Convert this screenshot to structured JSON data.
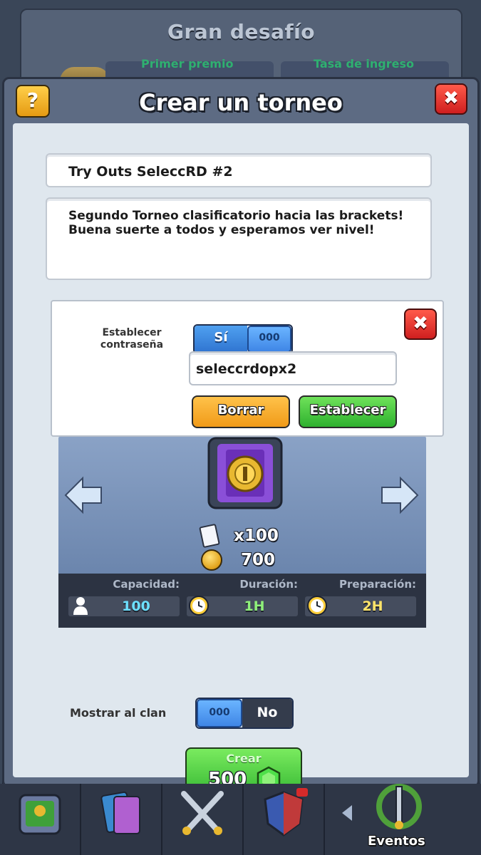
{
  "background": {
    "title": "Gran desafío",
    "first_prize_label": "Primer premio",
    "entry_fee_label": "Tasa de ingreso"
  },
  "modal": {
    "title": "Crear un torneo",
    "help_label": "?",
    "close_label": "✖"
  },
  "tournament": {
    "name": "Try Outs SeleccRD #2",
    "description": "Segundo Torneo clasificatorio hacia las brackets! Buena suerte a todos y esperamos ver nivel!"
  },
  "password": {
    "label": "Establecer contraseña",
    "toggle_on": "Sí",
    "toggle_knob": "000",
    "value": "seleccrdopx2",
    "clear_button": "Borrar",
    "set_button": "Establecer",
    "close_label": "✖"
  },
  "rewards": {
    "cards": "x100",
    "gold": "700"
  },
  "stats": {
    "capacity_label": "Capacidad:",
    "capacity_value": "100",
    "duration_label": "Duración:",
    "duration_value": "1H",
    "prep_label": "Preparación:",
    "prep_value": "2H"
  },
  "show_in_clan": {
    "label": "Mostrar al clan",
    "toggle_knob": "000",
    "toggle_off": "No"
  },
  "create": {
    "label": "Crear",
    "cost": "500"
  },
  "nav": {
    "events_label": "Eventos"
  },
  "colors": {
    "accent_green": "#2eb02e",
    "accent_orange": "#f09a18",
    "toggle_blue": "#2f74d0",
    "cyan_value": "#6de0ff",
    "yellow_value": "#ffe46a"
  }
}
